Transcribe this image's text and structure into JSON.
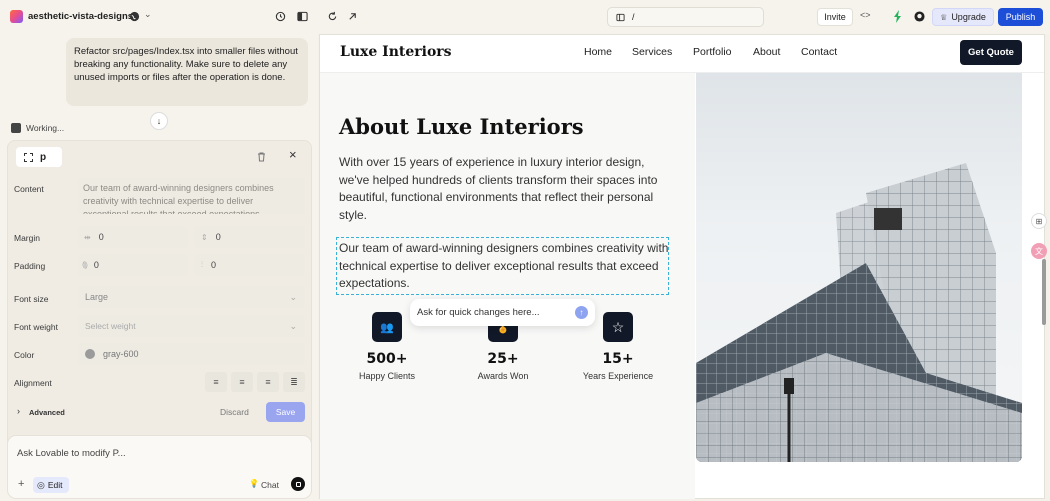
{
  "topbar": {
    "project_name": "aesthetic-vista-designs",
    "url_path": "/",
    "invite_label": "Invite",
    "upgrade_label": "Upgrade",
    "publish_label": "Publish"
  },
  "chat": {
    "user_message": "Refactor src/pages/Index.tsx into smaller files without breaking any functionality. Make sure to delete any unused imports or files after the operation is done.",
    "status": "Working..."
  },
  "inspector": {
    "element_tag": "p",
    "content_label": "Content",
    "content_value": "Our team of award-winning designers combines creativity with technical expertise to deliver exceptional results that exceed expectations.",
    "margin_label": "Margin",
    "margin_x": "0",
    "margin_y": "0",
    "padding_label": "Padding",
    "padding_x": "0",
    "padding_y": "0",
    "font_size_label": "Font size",
    "font_size_value": "Large",
    "font_weight_label": "Font weight",
    "font_weight_placeholder": "Select weight",
    "color_label": "Color",
    "color_value": "gray-600",
    "alignment_label": "Alignment",
    "advanced_label": "Advanced",
    "discard_label": "Discard",
    "save_label": "Save"
  },
  "composer": {
    "placeholder": "Ask Lovable to modify P...",
    "edit_label": "Edit",
    "chat_label": "Chat"
  },
  "site": {
    "logo": "Luxe Interiors",
    "nav": [
      "Home",
      "Services",
      "Portfolio",
      "About",
      "Contact"
    ],
    "cta": "Get Quote",
    "heading": "About Luxe Interiors",
    "para1": "With over 15 years of experience in luxury interior design, we've helped hundreds of clients transform their spaces into beautiful, functional environments that reflect their personal style.",
    "para2": "Our team of award-winning designers combines creativity with technical expertise to deliver exceptional results that exceed expectations.",
    "quick_placeholder": "Ask for quick changes here...",
    "stats": [
      {
        "num": "500+",
        "label": "Happy Clients"
      },
      {
        "num": "25+",
        "label": "Awards Won"
      },
      {
        "num": "15+",
        "label": "Years Experience"
      }
    ]
  },
  "colors": {
    "accent": "#1d4ed8",
    "upgrade_bg": "#e5e7fb",
    "save_bg": "#9aa5ef",
    "dark": "#111827"
  }
}
